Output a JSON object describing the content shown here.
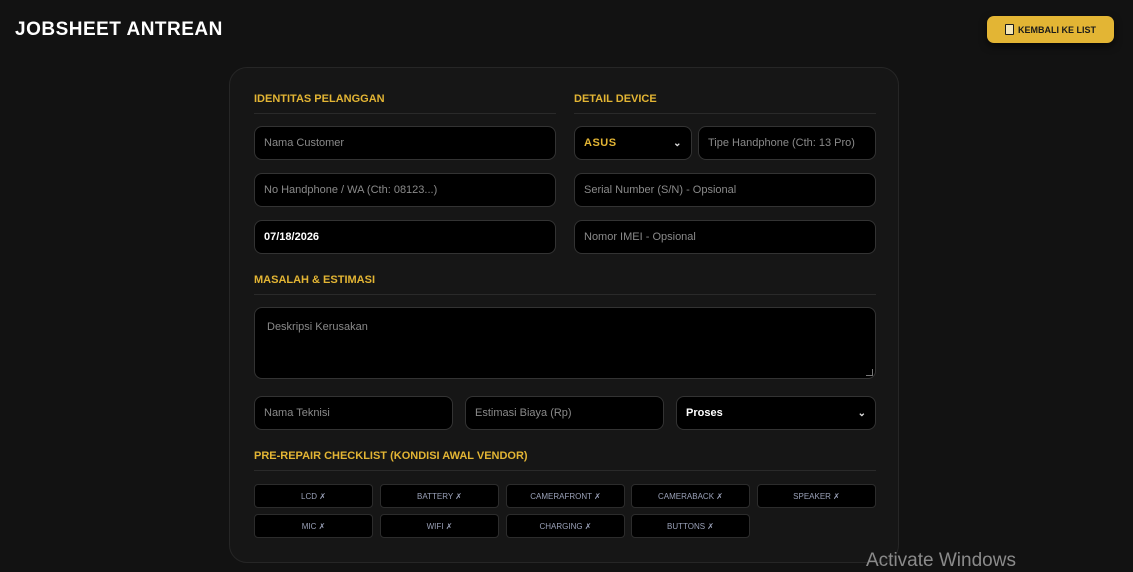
{
  "header": {
    "title": "JOBSHEET ANTREAN",
    "back_button": "KEMBALI KE LIST"
  },
  "sections": {
    "customer": "IDENTITAS PELANGGAN",
    "device": "DETAIL DEVICE",
    "problem": "MASALAH & ESTIMASI",
    "checklist": "PRE-REPAIR CHECKLIST (KONDISI AWAL VENDOR)"
  },
  "customer": {
    "name_placeholder": "Nama Customer",
    "phone_placeholder": "No Handphone / WA (Cth: 08123...)",
    "date_value": "07/18/2026"
  },
  "device": {
    "brand_selected": "ASUS",
    "type_placeholder": "Tipe Handphone (Cth: 13 Pro)",
    "serial_placeholder": "Serial Number (S/N) - Opsional",
    "imei_placeholder": "Nomor IMEI - Opsional"
  },
  "problem": {
    "description_placeholder": "Deskripsi Kerusakan",
    "technician_placeholder": "Nama Teknisi",
    "cost_placeholder": "Estimasi Biaya (Rp)",
    "status_selected": "Proses"
  },
  "checklist": [
    "LCD ✗",
    "BATTERY ✗",
    "CAMERAFRONT ✗",
    "CAMERABACK ✗",
    "SPEAKER ✗",
    "MIC ✗",
    "WIFI ✗",
    "CHARGING ✗",
    "BUTTONS ✗"
  ],
  "watermark": "Activate Windows",
  "colors": {
    "accent": "#e3b534",
    "background": "#121212",
    "card": "#161616",
    "field": "#000000"
  }
}
